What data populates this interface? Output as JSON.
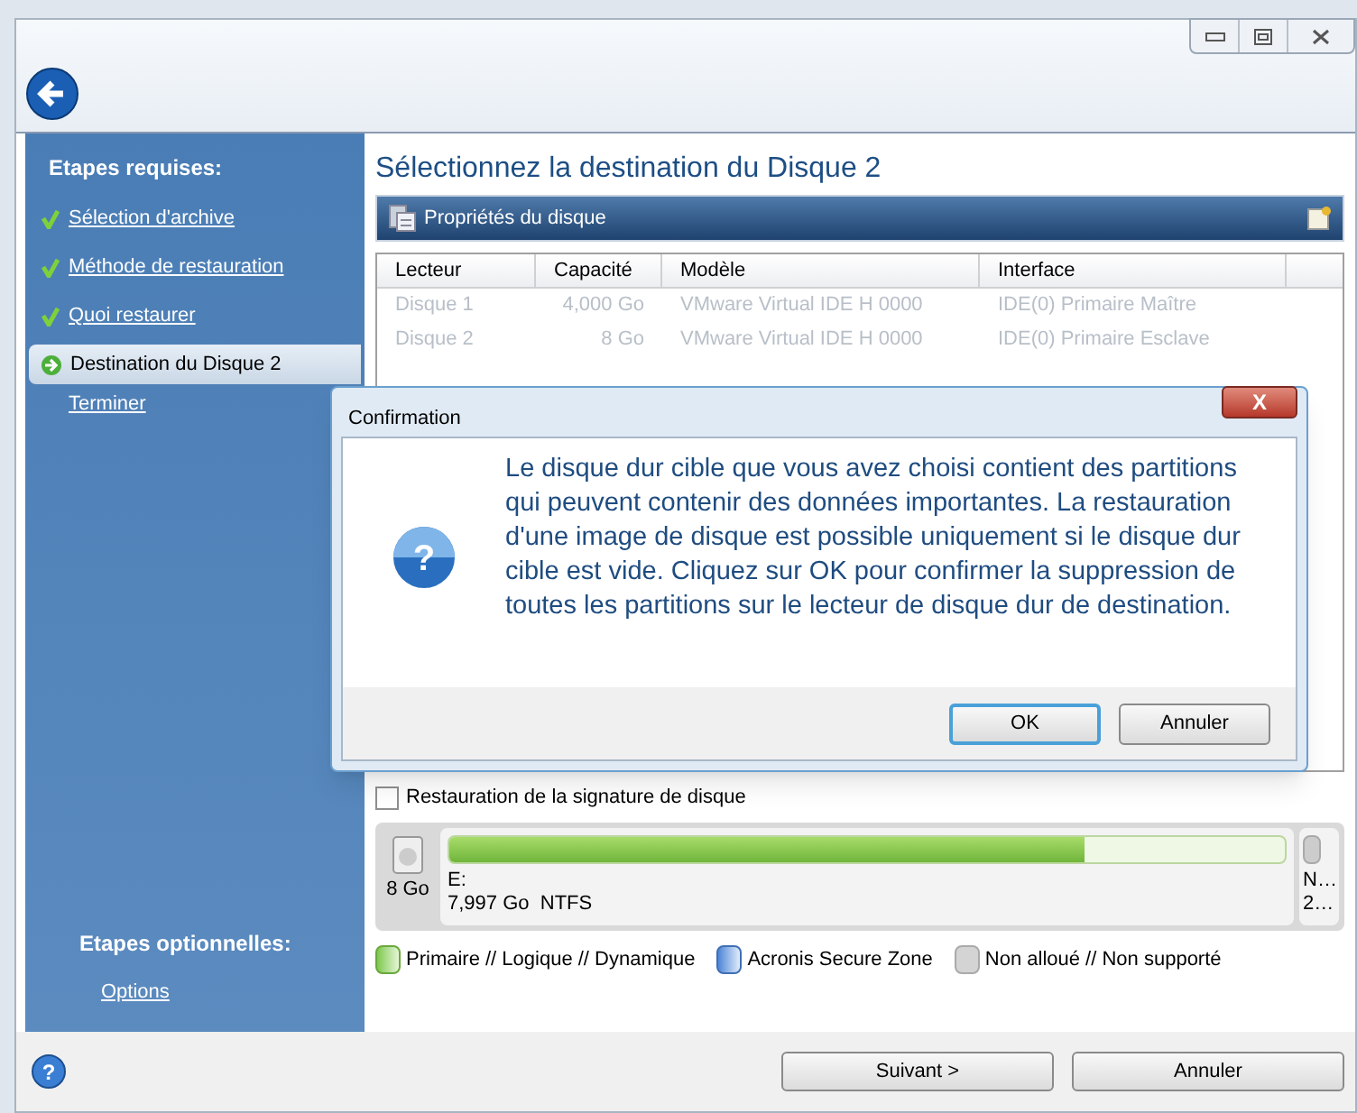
{
  "sidebar": {
    "required_heading": "Etapes requises:",
    "steps": [
      {
        "label": "Sélection d'archive",
        "kind": "done",
        "selected": false
      },
      {
        "label": "Méthode de restauration",
        "kind": "done",
        "selected": false
      },
      {
        "label": "Quoi restaurer",
        "kind": "done",
        "selected": false
      },
      {
        "label": "Destination du Disque 2",
        "kind": "current",
        "selected": true
      },
      {
        "label": "Terminer",
        "kind": "todo",
        "selected": false
      }
    ],
    "optional_heading": "Etapes optionnelles:",
    "optional_steps": [
      {
        "label": "Options"
      }
    ]
  },
  "main": {
    "title": "Sélectionnez la destination du Disque 2",
    "panel_title": "Propriétés du disque",
    "table": {
      "columns": [
        "Lecteur",
        "Capacité",
        "Modèle",
        "Interface"
      ],
      "rows": [
        [
          "Disque 1",
          "4,000 Go",
          "VMware Virtual IDE H 0000",
          "IDE(0) Primaire Maître"
        ],
        [
          "Disque 2",
          "8 Go",
          "VMware Virtual IDE H 0000",
          "IDE(0) Primaire Esclave"
        ]
      ]
    },
    "signature_checkbox": {
      "label": "Restauration de la signature de disque",
      "checked": false
    },
    "disk_map": {
      "disk_size": "8 Go",
      "partition": {
        "letter": "E:",
        "details": "7,997 Go  NTFS",
        "level": 0.76
      },
      "unallocated": {
        "line_1": "N…",
        "line_2": "2…"
      }
    },
    "legend": [
      {
        "kind": "primary",
        "label": "Primaire // Logique // Dynamique"
      },
      {
        "kind": "secure",
        "label": "Acronis Secure Zone"
      },
      {
        "kind": "unallocated",
        "label": "Non alloué // Non supporté"
      }
    ]
  },
  "footer": {
    "help": "?",
    "buttons": [
      "Suivant >",
      "Annuler"
    ]
  },
  "dialog": {
    "title": "Confirmation",
    "close": "X",
    "icon": "?",
    "message": "Le disque dur cible que vous avez choisi contient des partitions qui peuvent contenir des données importantes. La restauration d'une image de disque est possible uniquement si le disque dur cible est vide. Cliquez sur OK pour confirmer la suppression de toutes les partitions sur le lecteur de disque dur de destination.",
    "buttons": [
      "OK",
      "Annuler"
    ]
  }
}
